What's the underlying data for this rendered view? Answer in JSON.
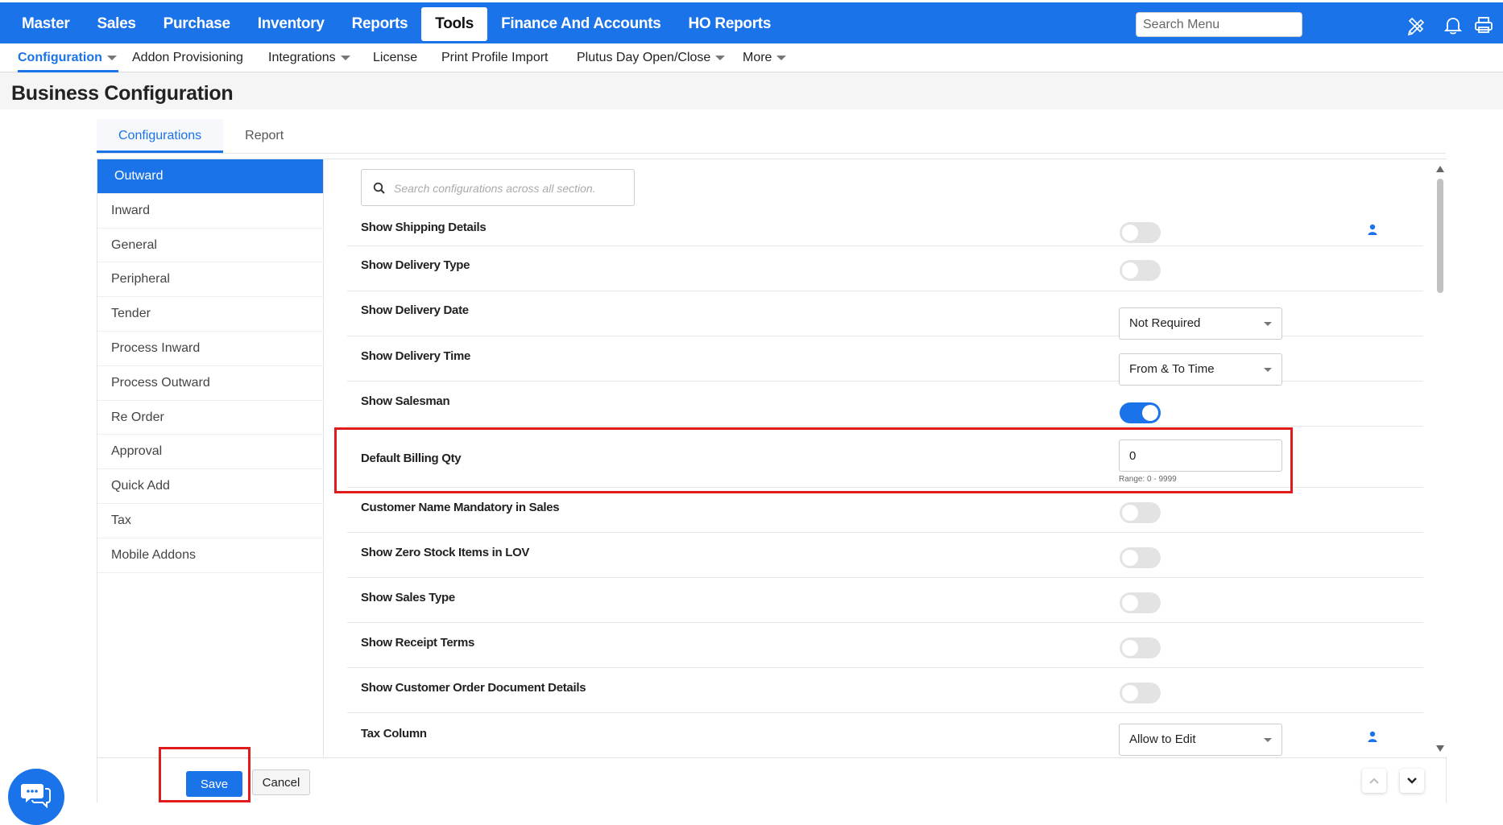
{
  "topnav": {
    "items": [
      "Master",
      "Sales",
      "Purchase",
      "Inventory",
      "Reports",
      "Tools",
      "Finance And Accounts",
      "HO Reports"
    ],
    "active": "Tools",
    "search_placeholder": "Search Menu",
    "icons": [
      "pencil-ruler-icon",
      "bell-icon",
      "printer-icon"
    ]
  },
  "subnav": {
    "items": [
      "Configuration",
      "Addon Provisioning",
      "Integrations",
      "License",
      "Print Profile Import",
      "Plutus Day Open/Close",
      "More"
    ],
    "active": "Configuration"
  },
  "page": {
    "title": "Business Configuration"
  },
  "tabs": {
    "items": [
      "Configurations",
      "Report"
    ],
    "active": "Configurations"
  },
  "sidebar": {
    "items": [
      "Outward",
      "Inward",
      "General",
      "Peripheral",
      "Tender",
      "Process Inward",
      "Process Outward",
      "Re Order",
      "Approval",
      "Quick Add",
      "Tax",
      "Mobile Addons"
    ],
    "active": "Outward"
  },
  "config_search": {
    "placeholder": "Search configurations across all section."
  },
  "settings": [
    {
      "label": "Show Shipping Details",
      "type": "toggle",
      "on": false,
      "person_icon": true
    },
    {
      "label": "Show Delivery Type",
      "type": "toggle",
      "on": false
    },
    {
      "label": "Show Delivery Date",
      "type": "select",
      "value": "Not Required"
    },
    {
      "label": "Show Delivery Time",
      "type": "select",
      "value": "From & To Time"
    },
    {
      "label": "Show Salesman",
      "type": "toggle",
      "on": true
    },
    {
      "label": "Default Billing Qty",
      "type": "number",
      "value": "0",
      "hint": "Range: 0 - 9999"
    },
    {
      "label": "Customer Name Mandatory in Sales",
      "type": "toggle",
      "on": false
    },
    {
      "label": "Show Zero Stock Items in LOV",
      "type": "toggle",
      "on": false
    },
    {
      "label": "Show Sales Type",
      "type": "toggle",
      "on": false
    },
    {
      "label": "Show Receipt Terms",
      "type": "toggle",
      "on": false
    },
    {
      "label": "Show Customer Order Document Details",
      "type": "toggle",
      "on": false
    },
    {
      "label": "Tax Column",
      "type": "select",
      "value": "Allow to Edit",
      "person_icon": true
    }
  ],
  "footer": {
    "save_label": "Save",
    "cancel_label": "Cancel"
  },
  "colors": {
    "primary": "#1a73e8",
    "highlight": "#e01b1b"
  }
}
